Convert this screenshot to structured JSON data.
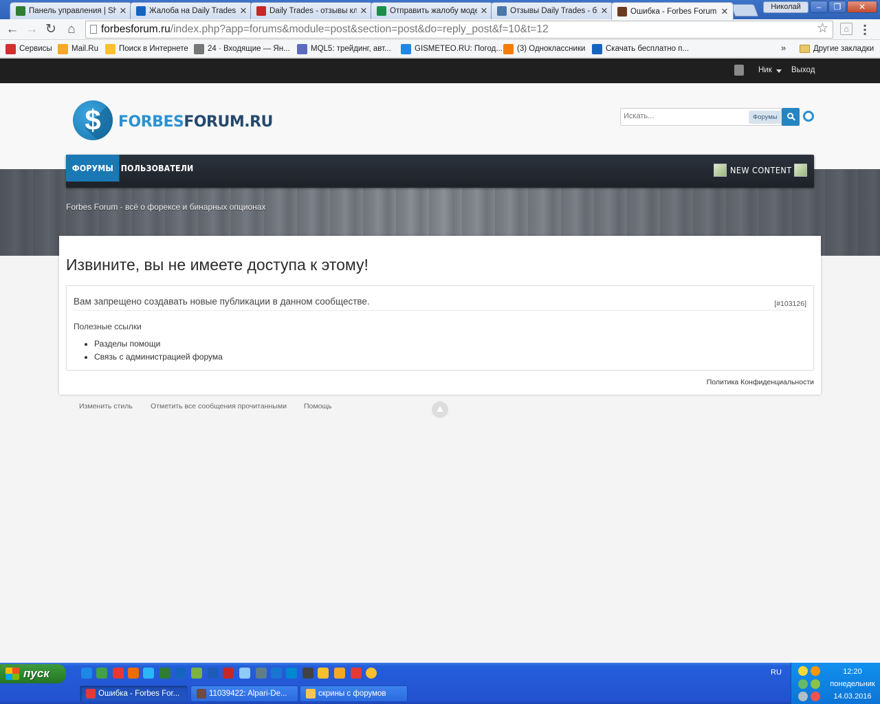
{
  "browser": {
    "tabs": [
      {
        "title": "Панель управления | Sh",
        "color": "#2e7d32",
        "active": false
      },
      {
        "title": "Жалоба на Daily Trades |",
        "color": "#1565c0",
        "active": false
      },
      {
        "title": "Daily Trades - отзывы кл",
        "color": "#c62828",
        "active": false
      },
      {
        "title": "Отправить жалобу моде",
        "color": "#1b8f4a",
        "active": false
      },
      {
        "title": "Отзывы Daily Trades - би",
        "color": "#4a76a8",
        "active": false
      },
      {
        "title": "Ошибка - Forbes Forum -",
        "color": "#6b3b1f",
        "active": true
      }
    ],
    "profile_name": "Николай",
    "url_host": "forbesforum.ru",
    "url_path": "/index.php?app=forums&module=post&section=post&do=reply_post&f=10&t=12",
    "bookmarks": [
      {
        "label": "Сервисы",
        "color": "#d32f2f"
      },
      {
        "label": "Mail.Ru",
        "color": "#f9a825"
      },
      {
        "label": "Поиск в Интернете",
        "color": "#fbc02d"
      },
      {
        "label": "24 · Входящие — Ян...",
        "color": "#777777"
      },
      {
        "label": "MQL5: трейдинг, авт...",
        "color": "#5c6bc0"
      },
      {
        "label": "GISMETEO.RU: Погод...",
        "color": "#1e88e5"
      },
      {
        "label": "(3) Одноклассники",
        "color": "#f57c00"
      },
      {
        "label": "Скачать бесплатно п...",
        "color": "#1565c0"
      }
    ],
    "other_bookmarks": "Другие закладки"
  },
  "site": {
    "userbar": {
      "nick": "Ник",
      "logout": "Выход"
    },
    "logo": {
      "part1": "FORBES",
      "part2": "FORUM.RU"
    },
    "search": {
      "placeholder": "Искать...",
      "scope": "Форумы"
    },
    "nav": {
      "forums": "ФОРУМЫ",
      "users": "ПОЛЬЗОВАТЕЛИ",
      "new_content": "NEW CONTENT"
    },
    "tagline": "Forbes Forum - всё о форексе и бинарных опционах",
    "error": {
      "title": "Извините, вы не имеете доступа к этому!",
      "message": "Вам запрещено создавать новые публикации в данном сообществе.",
      "code": "[#103126]",
      "useful_links_title": "Полезные ссылки",
      "links": [
        "Разделы помощи",
        "Связь с администрацией форума"
      ]
    },
    "privacy": "Политика Конфиденциальности",
    "footer": {
      "change_style": "Изменить стиль",
      "mark_read": "Отметить все сообщения прочитанными",
      "help": "Помощь"
    }
  },
  "taskbar": {
    "start_label": "пуск",
    "tasks": [
      {
        "label": "Ошибка - Forbes For...",
        "active": true,
        "color": "#e53935"
      },
      {
        "label": "11039422: Alpari-De...",
        "active": false,
        "color": "#6d4c41"
      },
      {
        "label": "скрины с форумов",
        "active": false,
        "color": "#f9c74f"
      }
    ],
    "lang": "RU",
    "time": "12:20",
    "weekday": "понедельник",
    "date": "14.03.2016"
  }
}
